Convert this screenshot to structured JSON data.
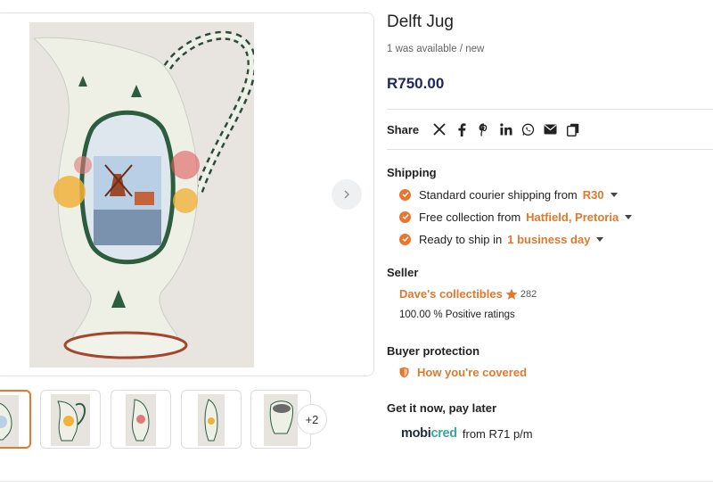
{
  "product": {
    "title": "Delft Jug",
    "availability": "1 was available / new",
    "price": "R750.00"
  },
  "gallery": {
    "more_count": "+2",
    "thumbnail_count": 5,
    "next_icon": "chevron-right-icon"
  },
  "share": {
    "label": "Share",
    "icons": [
      "x-icon",
      "facebook-icon",
      "pinterest-icon",
      "linkedin-icon",
      "whatsapp-icon",
      "email-icon",
      "copy-icon"
    ]
  },
  "shipping": {
    "title": "Shipping",
    "rows": [
      {
        "text": "Standard courier shipping from",
        "link": "R30"
      },
      {
        "text": "Free collection from",
        "link": "Hatfield, Pretoria"
      },
      {
        "text": "Ready to ship in",
        "link": "1 business day"
      }
    ]
  },
  "seller": {
    "title": "Seller",
    "name": "Dave's collectibles",
    "rating_count": "282",
    "ratings_text": "100.00 % Positive ratings"
  },
  "buyer_protection": {
    "title": "Buyer protection",
    "link": "How you're covered"
  },
  "pay_later": {
    "title": "Get it now, pay later",
    "logo_part1": "mobi",
    "logo_part2": "cred",
    "text": "from R71 p/m"
  },
  "colors": {
    "accent": "#e0782d",
    "price": "#22285a",
    "mobicred_teal": "#39a7a0"
  }
}
